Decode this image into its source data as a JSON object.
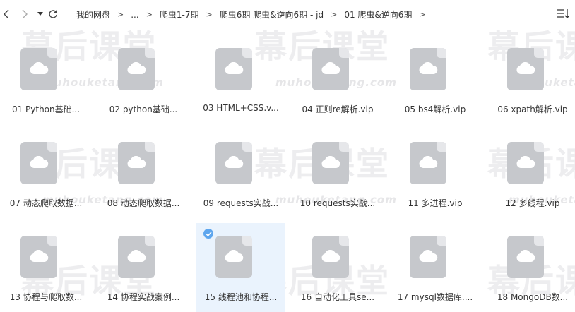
{
  "nav": {
    "back_icon": "chevron-left-icon",
    "forward_icon": "chevron-right-icon",
    "history_icon": "caret-down-icon",
    "refresh_icon": "refresh-icon",
    "view_icon": "sort-view-icon"
  },
  "breadcrumb": {
    "items": [
      "我的网盘",
      "...",
      "爬虫1-7期",
      "爬虫6期 爬虫&逆向6期 - jd",
      "01 爬虫&逆向6期"
    ],
    "separator": ">"
  },
  "watermark": {
    "text": "幕后课堂",
    "subtext": "muhouketang.com"
  },
  "files": [
    {
      "label": "01 Python基础..."
    },
    {
      "label": "02 python基础..."
    },
    {
      "label": "03 HTML+CSS.v..."
    },
    {
      "label": "04 正则re解析.vip"
    },
    {
      "label": "05 bs4解析.vip"
    },
    {
      "label": "06 xpath解析.vip"
    },
    {
      "label": "07 动态爬取数据..."
    },
    {
      "label": "08 动态爬取数据..."
    },
    {
      "label": "09 requests实战..."
    },
    {
      "label": "10 requests实战..."
    },
    {
      "label": "11 多进程.vip"
    },
    {
      "label": "12 多线程.vip"
    },
    {
      "label": "13 协程与爬取数..."
    },
    {
      "label": "14 协程实战案例..."
    },
    {
      "label": "15 线程池和协程..."
    },
    {
      "label": "16 自动化工具se..."
    },
    {
      "label": "17 mysql数据库...."
    },
    {
      "label": "18 MongoDB数..."
    }
  ],
  "selected_index": 14,
  "colors": {
    "icon_fill": "#c6c8cc",
    "selection_bg": "#eaf3fd",
    "check": "#5ea6ee"
  }
}
